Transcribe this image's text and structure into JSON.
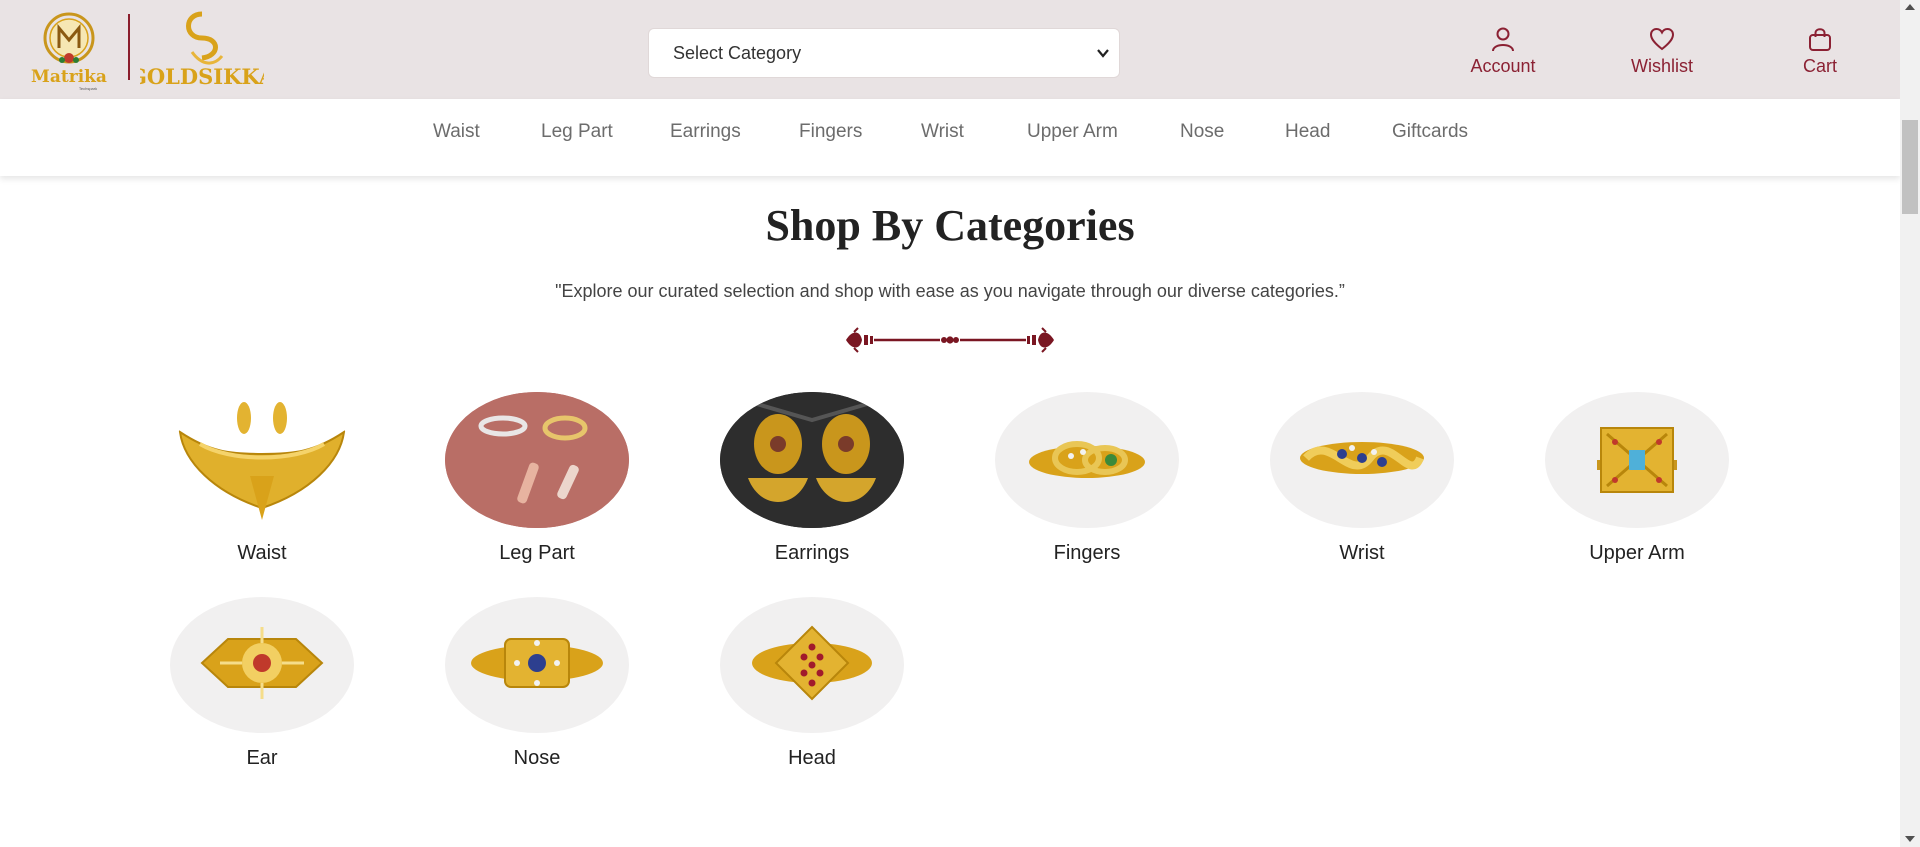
{
  "header": {
    "logo_left": {
      "brand_text": "Matrika",
      "tagline": "Techspark",
      "monogram": "M"
    },
    "logo_right": {
      "brand_text": "GOLDSIKKA",
      "monogram": "G"
    },
    "category_select": {
      "selected": "Select Category",
      "icon": "chevron-down-icon"
    },
    "actions": [
      {
        "label": "Account",
        "icon": "user-icon"
      },
      {
        "label": "Wishlist",
        "icon": "heart-icon"
      },
      {
        "label": "Cart",
        "icon": "bag-icon"
      }
    ],
    "colors": {
      "background": "#e9e3e4",
      "accent": "#8b2133",
      "gold": "#d9a21a"
    }
  },
  "nav": {
    "items": [
      "Waist",
      "Leg Part",
      "Earrings",
      "Fingers",
      "Wrist",
      "Upper Arm",
      "Nose",
      "Head",
      "Giftcards"
    ]
  },
  "section": {
    "title": "Shop By Categories",
    "subtitle": "\"Explore our curated selection and shop with ease as you navigate through our diverse categories.”",
    "ornament_icon": "ornament-divider-icon"
  },
  "categories": [
    {
      "label": "Waist",
      "image": "gold-necklace-set"
    },
    {
      "label": "Leg Part",
      "image": "toe-rings-on-pink"
    },
    {
      "label": "Earrings",
      "image": "temple-jhumka-earrings"
    },
    {
      "label": "Fingers",
      "image": "gold-ring-with-stones"
    },
    {
      "label": "Wrist",
      "image": "gold-twist-ring-sapphire"
    },
    {
      "label": "Upper Arm",
      "image": "gold-square-ring-blue-stone"
    },
    {
      "label": "Ear",
      "image": "gold-ring-red-stone"
    },
    {
      "label": "Nose",
      "image": "gold-ring-blue-stone"
    },
    {
      "label": "Head",
      "image": "gold-ring-ruby-cluster"
    }
  ]
}
